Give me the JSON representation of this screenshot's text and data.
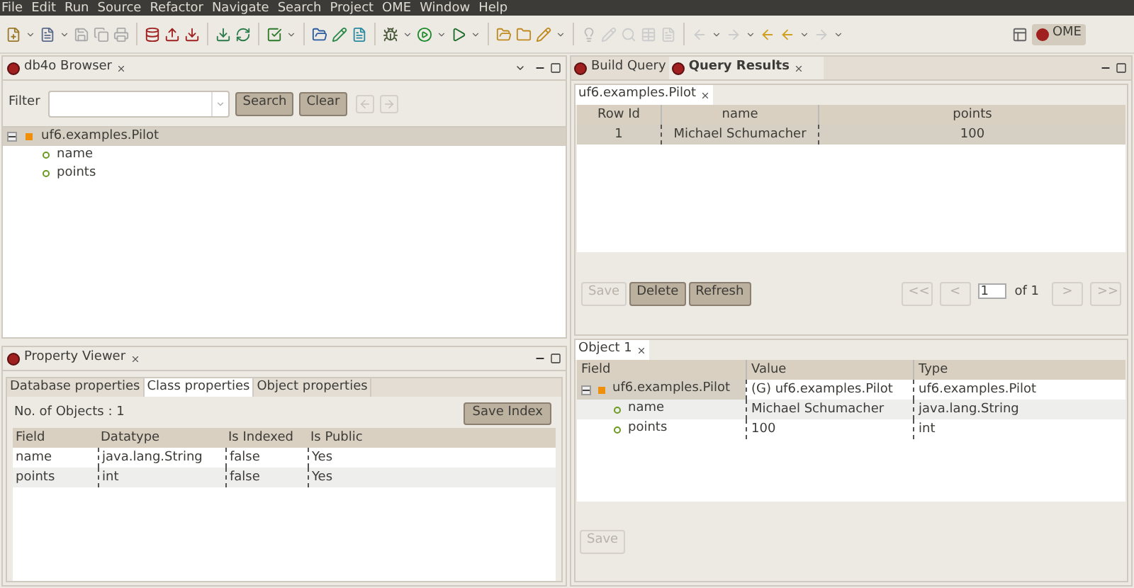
{
  "menu": [
    "File",
    "Edit",
    "Run",
    "Source",
    "Refactor",
    "Navigate",
    "Search",
    "Project",
    "OME",
    "Window",
    "Help"
  ],
  "perspective": {
    "label": "OME",
    "selected": true
  },
  "browser": {
    "title": "db4o Browser",
    "filter_label": "Filter",
    "buttons": [
      {
        "label": "Search",
        "disabled": false
      },
      {
        "label": "Clear",
        "disabled": false
      }
    ],
    "tree": [
      {
        "label": "uf6.examples.Pilot",
        "expanded": true,
        "selected": true,
        "children": [
          {
            "label": "name"
          },
          {
            "label": "points"
          }
        ]
      }
    ]
  },
  "property_viewer": {
    "title": "Property Viewer",
    "tabs": [
      {
        "label": "Database properties",
        "selected": false
      },
      {
        "label": "Class properties",
        "selected": true
      },
      {
        "label": "Object properties",
        "selected": false
      }
    ],
    "count": "No. of Objects : 1",
    "save_button": "Save Index",
    "columns": [
      "Field",
      "Datatype",
      "Is Indexed",
      "Is Public"
    ],
    "rows": [
      [
        "name",
        "java.lang.String",
        "false",
        "Yes"
      ],
      [
        "points",
        "int",
        "false",
        "Yes"
      ]
    ]
  },
  "results": {
    "tabs": [
      {
        "label": "Build Query",
        "selected": false
      },
      {
        "label": "Query Results",
        "selected": true
      }
    ],
    "inner_tab": "uf6.examples.Pilot",
    "columns": [
      "Row Id",
      "name",
      "points"
    ],
    "rows": [
      {
        "cells": [
          "1",
          "Michael Schumacher",
          "100"
        ],
        "selected": true
      }
    ],
    "buttons": [
      {
        "label": "Save",
        "disabled": true
      },
      {
        "label": "Delete",
        "disabled": false
      },
      {
        "label": "Refresh",
        "disabled": false
      }
    ],
    "pager_prev": [
      {
        "label": "<<",
        "disabled": true
      },
      {
        "label": "<",
        "disabled": true
      }
    ],
    "page": "1",
    "page_of": "of 1",
    "pager_next": [
      {
        "label": ">",
        "disabled": true
      },
      {
        "label": ">>",
        "disabled": true
      }
    ]
  },
  "object": {
    "tab": "Object 1",
    "columns": [
      "Field",
      "Value",
      "Type"
    ],
    "tree": [
      {
        "cells": [
          "uf6.examples.Pilot",
          "(G) uf6.examples.Pilot",
          "uf6.examples.Pilot"
        ],
        "expanded": true,
        "selected": true,
        "children": [
          {
            "cells": [
              "name",
              "Michael Schumacher",
              "java.lang.String"
            ]
          },
          {
            "cells": [
              "points",
              "100",
              "int"
            ]
          }
        ]
      }
    ],
    "save": {
      "label": "Save",
      "disabled": true
    }
  }
}
